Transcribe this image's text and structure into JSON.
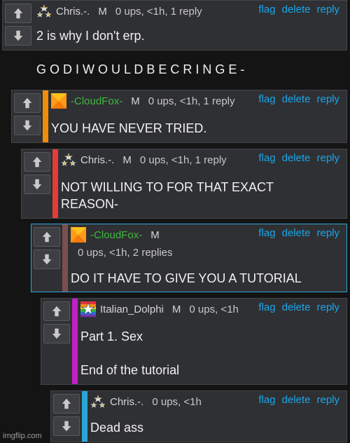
{
  "comments": [
    {
      "username": "Chris.-.",
      "badge": "M",
      "stats": "0 ups, <1h, 1 reply",
      "body": "2 is why I don't erp.\n\nG O D I W O U L D B E C R I N G E -",
      "stripe_color": "#2f3033",
      "avatar": "star-triangle-avatar",
      "actions": {
        "flag": "flag",
        "delete": "delete",
        "reply": "reply"
      }
    },
    {
      "username": "-CloudFox-",
      "badge": "M",
      "stats": "0 ups, <1h, 1 reply",
      "body": "YOU HAVE NEVER TRIED.",
      "stripe_color": "#f08c0a",
      "avatar": "orange-pinwheel-avatar",
      "actions": {
        "flag": "flag",
        "delete": "delete",
        "reply": "reply"
      }
    },
    {
      "username": "Chris.-.",
      "badge": "M",
      "stats": "0 ups, <1h, 1 reply",
      "body": "NOT WILLING TO FOR THAT EXACT\nREASON-",
      "stripe_color": "#e53b3b",
      "avatar": "star-triangle-avatar",
      "actions": {
        "flag": "flag",
        "delete": "delete",
        "reply": "reply"
      }
    },
    {
      "username": "-CloudFox-",
      "badge": "M",
      "stats": "0 ups, <1h, 2 replies",
      "body": "DO IT HAVE TO GIVE YOU A TUTORIAL",
      "stripe_color": "#7a4f4f",
      "avatar": "orange-pinwheel-avatar",
      "actions": {
        "flag": "flag",
        "delete": "delete",
        "reply": "reply"
      }
    },
    {
      "username": "Italian_Dolphi",
      "badge": "M",
      "stats": "0 ups, <1h",
      "body": "Part 1. Sex\n\nEnd of the tutorial",
      "stripe_color": "#c21fc7",
      "avatar": "rainbow-star-avatar",
      "actions": {
        "flag": "flag",
        "delete": "delete",
        "reply": "reply"
      }
    },
    {
      "username": "Chris.-.",
      "badge": "",
      "stats": "0 ups, <1h",
      "body": "Dead ass",
      "stripe_color": "#2aa6d8",
      "avatar": "star-triangle-avatar",
      "actions": {
        "flag": "flag",
        "delete": "delete",
        "reply": "reply"
      }
    }
  ],
  "watermark": "imgflip.com",
  "colors": {
    "link": "#1ba6e8",
    "background": "#141414",
    "card": "#2f3033"
  }
}
